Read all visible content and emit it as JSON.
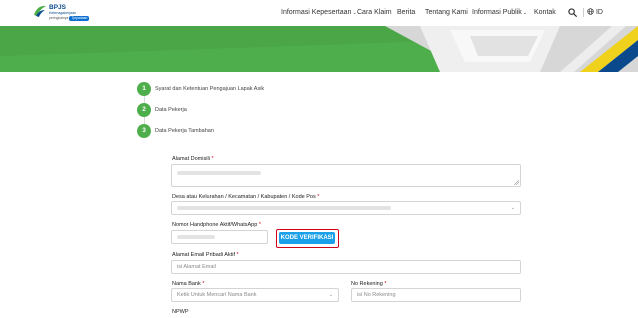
{
  "brand": {
    "title": "BPJS",
    "subtitle": "Ketenagakerjaan",
    "tagline_prefix": "peringkatnya",
    "tagline_pill": "Tjepadaan",
    "colors": {
      "green": "#4fae4c",
      "blue": "#0a4a8c",
      "yellow": "#f0d21c"
    }
  },
  "nav": {
    "items": [
      {
        "label": "Informasi Kepesertaan",
        "has_dropdown": true
      },
      {
        "label": "Cara Klaim",
        "has_dropdown": false
      },
      {
        "label": "Berita",
        "has_dropdown": false
      },
      {
        "label": "Tentang Kami",
        "has_dropdown": false
      },
      {
        "label": "Informasi Publik",
        "has_dropdown": true
      },
      {
        "label": "Kontak",
        "has_dropdown": false
      }
    ],
    "dropdown_glyph": "⌄",
    "search_icon": "search-icon",
    "globe_icon": "globe-icon",
    "language": "ID"
  },
  "steps": [
    {
      "number": "1",
      "label": "Syarat dan Ketentuan Pengajuan Lapak Asik"
    },
    {
      "number": "2",
      "label": "Data Pekerja"
    },
    {
      "number": "3",
      "label": "Data Pekerja Tambahan"
    }
  ],
  "form": {
    "alamat_domisili": {
      "label": "Alamat Domisili",
      "required": "*"
    },
    "desa": {
      "label": "Desa atau Kelurahan / Kecamatan / Kabupaten / Kode Pos",
      "required": "*"
    },
    "nomor_hp": {
      "label": "Nomor Handphone Aktif/WhatsApp",
      "required": "*"
    },
    "kode_verifikasi_button": "KODE VERIFIKASI",
    "email": {
      "label": "Alamat Email Pribadi Aktif",
      "required": "*",
      "placeholder": "isi Alamat Email"
    },
    "nama_bank": {
      "label": "Nama Bank",
      "required": "*",
      "placeholder": "Ketik Untuk Mencari Nama Bank"
    },
    "no_rekening": {
      "label": "No Rekening",
      "required": "*",
      "placeholder": "isi No Rekening"
    },
    "npwp": {
      "label": "NPWP"
    },
    "select_glyph": "⌄"
  }
}
